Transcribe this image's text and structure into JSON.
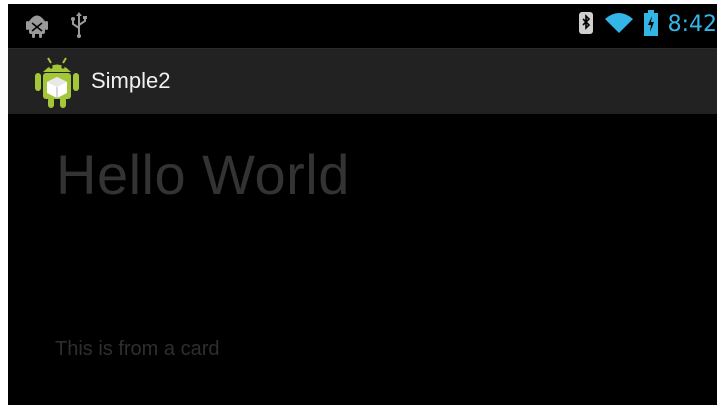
{
  "status_bar": {
    "time": "8:42",
    "time_color": "#33b5e5",
    "icons_left": [
      "android-debug-icon",
      "usb-icon"
    ],
    "icons_right": [
      "bluetooth-icon",
      "wifi-icon",
      "battery-charging-icon"
    ]
  },
  "action_bar": {
    "app_icon": "android-app-icon",
    "title": "Simple2"
  },
  "content": {
    "headline": "Hello World",
    "card_text": "This is from a card"
  },
  "colors": {
    "background": "#000000",
    "action_bar": "#222222",
    "accent": "#33b5e5",
    "android_green": "#a4c639"
  }
}
